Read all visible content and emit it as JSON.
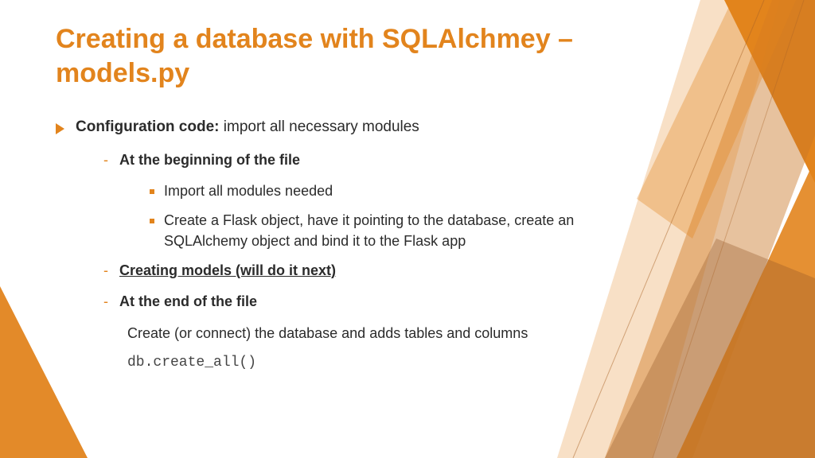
{
  "title": "Creating a database with SQLAlchmey – models.py",
  "lvl1": {
    "bold": "Configuration code: ",
    "rest": "import all necessary modules"
  },
  "sub": {
    "beginning": "At the beginning of the file",
    "beg_a": "Import all modules needed",
    "beg_b": "Create a Flask object, have it pointing to the database, create an SQLAlchemy object and bind it to the Flask app",
    "creating": "Creating models (will do it next)",
    "endfile": "At the end of the file",
    "end_desc": "Create (or connect) the database and adds tables and columns",
    "end_code": "db.create_all()"
  }
}
